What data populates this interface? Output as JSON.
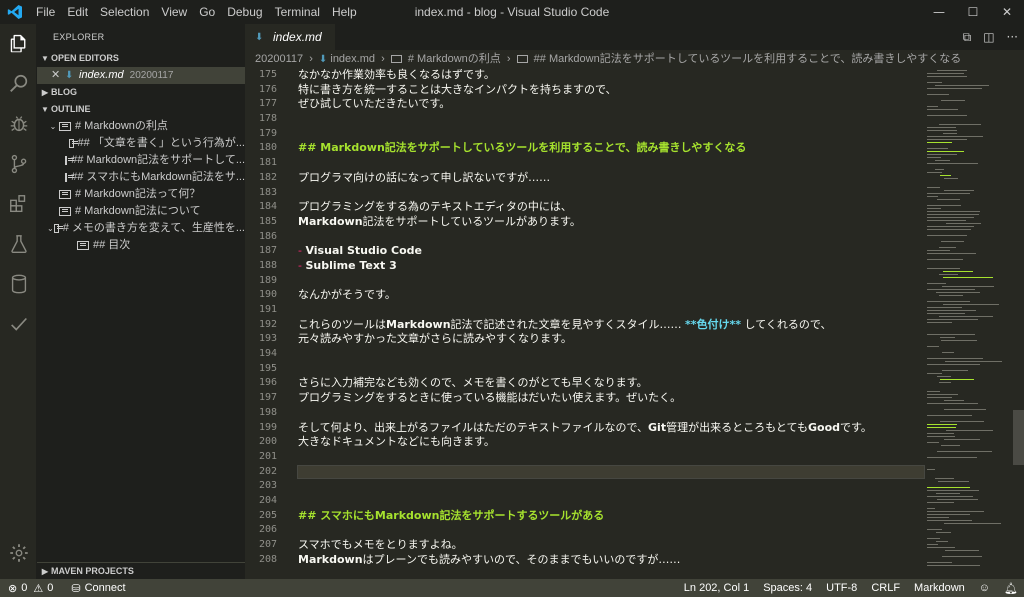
{
  "window": {
    "title": "index.md - blog - Visual Studio Code",
    "menu": [
      "File",
      "Edit",
      "Selection",
      "View",
      "Go",
      "Debug",
      "Terminal",
      "Help"
    ],
    "controls": [
      "—",
      "☐",
      "✕"
    ]
  },
  "sidebar": {
    "title": "EXPLORER",
    "open_editors_label": "OPEN EDITORS",
    "open_editor": {
      "name": "index.md",
      "folder": "20200117"
    },
    "blog_label": "BLOG",
    "outline_label": "OUTLINE",
    "outline": [
      {
        "label": "# Markdownの利点",
        "indent": 1,
        "chevron": "⌄"
      },
      {
        "label": "## 「文章を書く」という行為が...",
        "indent": 2,
        "chevron": ""
      },
      {
        "label": "## Markdown記法をサポートして...",
        "indent": 2,
        "chevron": ""
      },
      {
        "label": "## スマホにもMarkdown記法をサ...",
        "indent": 2,
        "chevron": ""
      },
      {
        "label": "# Markdown記法って何？",
        "indent": 1,
        "chevron": ""
      },
      {
        "label": "# Markdown記法について",
        "indent": 1,
        "chevron": ""
      },
      {
        "label": "# メモの書き方を変えて、生産性を...",
        "indent": 1,
        "chevron": "⌄"
      },
      {
        "label": "## 目次",
        "indent": 2,
        "chevron": ""
      }
    ],
    "maven_label": "MAVEN PROJECTS"
  },
  "editor": {
    "tab": "index.md",
    "breadcrumb": [
      "20200117",
      "index.md",
      "# Markdownの利点",
      "## Markdown記法をサポートしているツールを利用することで、読み書きしやすくなる"
    ],
    "lines": [
      {
        "n": "175",
        "parts": [
          {
            "t": "なかなか作業効率も良くなるはずです。",
            "s": ""
          }
        ]
      },
      {
        "n": "176",
        "parts": [
          {
            "t": "特に書き方を統一することは大きなインパクトを持ちますので、",
            "s": ""
          }
        ]
      },
      {
        "n": "177",
        "parts": [
          {
            "t": "ぜひ試していただきたいです。",
            "s": ""
          }
        ]
      },
      {
        "n": "178",
        "parts": []
      },
      {
        "n": "179",
        "parts": []
      },
      {
        "n": "180",
        "parts": [
          {
            "t": "## Markdown記法をサポートしているツールを利用することで、読み書きしやすくなる",
            "s": "heading"
          }
        ]
      },
      {
        "n": "181",
        "parts": []
      },
      {
        "n": "182",
        "parts": [
          {
            "t": "プログラマ向けの話になって申し訳ないですが……",
            "s": ""
          }
        ]
      },
      {
        "n": "183",
        "parts": []
      },
      {
        "n": "184",
        "parts": [
          {
            "t": "プログラミングをする為のテキストエディタの中には、",
            "s": ""
          }
        ]
      },
      {
        "n": "185",
        "parts": [
          {
            "t": "Markdown",
            "s": "bold"
          },
          {
            "t": "記法をサポートしているツールがあります。",
            "s": ""
          }
        ]
      },
      {
        "n": "186",
        "parts": []
      },
      {
        "n": "187",
        "parts": [
          {
            "t": "- ",
            "s": "listmark"
          },
          {
            "t": "Visual Studio Code",
            "s": "bold"
          }
        ]
      },
      {
        "n": "188",
        "parts": [
          {
            "t": "- ",
            "s": "listmark"
          },
          {
            "t": "Sublime Text 3",
            "s": "bold"
          }
        ]
      },
      {
        "n": "189",
        "parts": []
      },
      {
        "n": "190",
        "parts": [
          {
            "t": "なんかがそうです。",
            "s": ""
          }
        ]
      },
      {
        "n": "191",
        "parts": []
      },
      {
        "n": "192",
        "parts": [
          {
            "t": "これらのツールは",
            "s": ""
          },
          {
            "t": "Markdown",
            "s": "bold"
          },
          {
            "t": "記法で記述された文章を見やすくスタイル…… ",
            "s": ""
          },
          {
            "t": "**色付け**",
            "s": "colored"
          },
          {
            "t": " してくれるので、",
            "s": ""
          }
        ]
      },
      {
        "n": "193",
        "parts": [
          {
            "t": "元々読みやすかった文章がさらに読みやすくなります。",
            "s": ""
          }
        ]
      },
      {
        "n": "194",
        "parts": []
      },
      {
        "n": "195",
        "parts": []
      },
      {
        "n": "196",
        "parts": [
          {
            "t": "さらに入力補完なども効くので、メモを書くのがとても早くなります。",
            "s": ""
          }
        ]
      },
      {
        "n": "197",
        "parts": [
          {
            "t": "プログラミングをするときに使っている機能はだいたい使えます。ぜいたく。",
            "s": ""
          }
        ]
      },
      {
        "n": "198",
        "parts": []
      },
      {
        "n": "199",
        "parts": [
          {
            "t": "そして何より、出来上がるファイルはただのテキストファイルなので、",
            "s": ""
          },
          {
            "t": "Git",
            "s": "bold"
          },
          {
            "t": "管理が出来るところもとても",
            "s": ""
          },
          {
            "t": "Good",
            "s": "bold"
          },
          {
            "t": "です。",
            "s": ""
          }
        ]
      },
      {
        "n": "200",
        "parts": [
          {
            "t": "大きなドキュメントなどにも向きます。",
            "s": ""
          }
        ]
      },
      {
        "n": "201",
        "parts": []
      },
      {
        "n": "202",
        "parts": [],
        "current": true
      },
      {
        "n": "203",
        "parts": []
      },
      {
        "n": "204",
        "parts": []
      },
      {
        "n": "205",
        "parts": [
          {
            "t": "## スマホにもMarkdown記法をサポートするツールがある",
            "s": "heading"
          }
        ]
      },
      {
        "n": "206",
        "parts": []
      },
      {
        "n": "207",
        "parts": [
          {
            "t": "スマホでもメモをとりますよね。",
            "s": ""
          }
        ]
      },
      {
        "n": "208",
        "parts": [
          {
            "t": "Markdown",
            "s": "bold"
          },
          {
            "t": "はプレーンでも読みやすいので、そのままでもいいのですが……",
            "s": ""
          }
        ]
      }
    ]
  },
  "statusbar": {
    "errors": "0",
    "warnings": "0",
    "connect": "Connect",
    "position": "Ln 202, Col 1",
    "spaces": "Spaces: 4",
    "encoding": "UTF-8",
    "eol": "CRLF",
    "language": "Markdown"
  },
  "colors": {
    "heading": "#a6e22e",
    "listmark": "#f92672",
    "colored": "#66d9ef",
    "editor_bg": "#272822"
  }
}
